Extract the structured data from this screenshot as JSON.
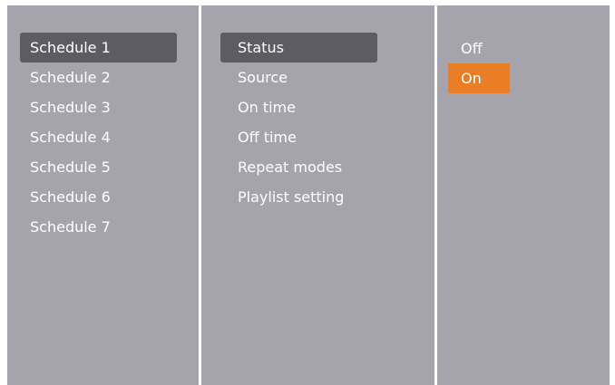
{
  "schedules": {
    "items": [
      {
        "label": "Schedule 1"
      },
      {
        "label": "Schedule 2"
      },
      {
        "label": "Schedule 3"
      },
      {
        "label": "Schedule 4"
      },
      {
        "label": "Schedule 5"
      },
      {
        "label": "Schedule 6"
      },
      {
        "label": "Schedule 7"
      }
    ],
    "selected_index": 0
  },
  "settings": {
    "items": [
      {
        "label": "Status"
      },
      {
        "label": "Source"
      },
      {
        "label": "On time"
      },
      {
        "label": "Off time"
      },
      {
        "label": "Repeat modes"
      },
      {
        "label": "Playlist setting"
      }
    ],
    "selected_index": 0
  },
  "options": {
    "items": [
      {
        "label": "Off"
      },
      {
        "label": "On"
      }
    ],
    "active_index": 1
  },
  "colors": {
    "panel": "#a5a3ac",
    "selected": "#5d5c62",
    "active": "#ea7e24",
    "text": "#ffffff"
  }
}
